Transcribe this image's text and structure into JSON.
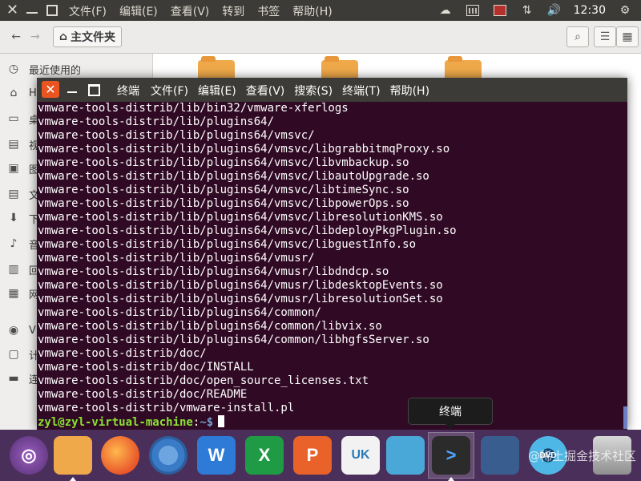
{
  "top_panel": {
    "menu": [
      "文件(F)",
      "编辑(E)",
      "查看(V)",
      "转到",
      "书签",
      "帮助(H)"
    ],
    "tray_icons": [
      "weather-icon",
      "calendar-icon",
      "screenshot-icon",
      "network-arrows-icon",
      "volume-icon"
    ],
    "clock": "12:30"
  },
  "file_manager": {
    "location": "主文件夹",
    "sidebar": [
      {
        "label": "最近使用的",
        "icon": "clock-icon"
      },
      {
        "label": "H",
        "icon": "home-icon"
      },
      {
        "label": "桌",
        "icon": "desktop-icon"
      },
      {
        "label": "视",
        "icon": "video-icon"
      },
      {
        "label": "图",
        "icon": "picture-icon"
      },
      {
        "label": "文",
        "icon": "document-icon"
      },
      {
        "label": "下",
        "icon": "download-icon"
      },
      {
        "label": "音",
        "icon": "music-icon"
      },
      {
        "label": "回",
        "icon": "trash-icon"
      },
      {
        "label": "网",
        "icon": "network-icon"
      },
      {
        "label": "V",
        "icon": "disc-icon"
      },
      {
        "label": "计",
        "icon": "computer-icon"
      },
      {
        "label": "连",
        "icon": "connect-server-icon"
      }
    ]
  },
  "terminal": {
    "title": "终端",
    "menu": [
      "文件(F)",
      "编辑(E)",
      "查看(V)",
      "搜索(S)",
      "终端(T)",
      "帮助(H)"
    ],
    "lines": [
      "vmware-tools-distrib/lib/bin32/vmware-xferlogs",
      "vmware-tools-distrib/lib/plugins64/",
      "vmware-tools-distrib/lib/plugins64/vmsvc/",
      "vmware-tools-distrib/lib/plugins64/vmsvc/libgrabbitmqProxy.so",
      "vmware-tools-distrib/lib/plugins64/vmsvc/libvmbackup.so",
      "vmware-tools-distrib/lib/plugins64/vmsvc/libautoUpgrade.so",
      "vmware-tools-distrib/lib/plugins64/vmsvc/libtimeSync.so",
      "vmware-tools-distrib/lib/plugins64/vmsvc/libpowerOps.so",
      "vmware-tools-distrib/lib/plugins64/vmsvc/libresolutionKMS.so",
      "vmware-tools-distrib/lib/plugins64/vmsvc/libdeployPkgPlugin.so",
      "vmware-tools-distrib/lib/plugins64/vmsvc/libguestInfo.so",
      "vmware-tools-distrib/lib/plugins64/vmusr/",
      "vmware-tools-distrib/lib/plugins64/vmusr/libdndcp.so",
      "vmware-tools-distrib/lib/plugins64/vmusr/libdesktopEvents.so",
      "vmware-tools-distrib/lib/plugins64/vmusr/libresolutionSet.so",
      "vmware-tools-distrib/lib/plugins64/common/",
      "vmware-tools-distrib/lib/plugins64/common/libvix.so",
      "vmware-tools-distrib/lib/plugins64/common/libhgfsServer.so",
      "vmware-tools-distrib/doc/",
      "vmware-tools-distrib/doc/INSTALL",
      "vmware-tools-distrib/doc/open_source_licenses.txt",
      "vmware-tools-distrib/doc/README",
      "vmware-tools-distrib/vmware-install.pl"
    ],
    "prompt_user": "zyl@zyl-virtual-machine",
    "prompt_sep": ":",
    "prompt_path": "~$"
  },
  "tooltip": "终端",
  "dock": [
    {
      "name": "ubuntu-dash",
      "label": ""
    },
    {
      "name": "files",
      "label": ""
    },
    {
      "name": "firefox",
      "label": ""
    },
    {
      "name": "chromium",
      "label": ""
    },
    {
      "name": "writer",
      "label": "W"
    },
    {
      "name": "spreadsheet",
      "label": "X"
    },
    {
      "name": "presentation",
      "label": "P"
    },
    {
      "name": "software-center",
      "label": "UK"
    },
    {
      "name": "remote-desktop",
      "label": ""
    },
    {
      "name": "terminal",
      "label": ">"
    },
    {
      "name": "workspace-switcher",
      "label": ""
    },
    {
      "name": "dvd",
      "label": "DVD"
    },
    {
      "name": "trash",
      "label": ""
    }
  ],
  "watermark": "@稀土掘金技术社区",
  "colors": {
    "terminal_bg": "#300a24",
    "panel_bg": "#3c3b37",
    "dock_bg": "#4a2f5a",
    "close_orange": "#e95420",
    "prompt_green": "#8ae234",
    "prompt_blue": "#729fcf"
  }
}
